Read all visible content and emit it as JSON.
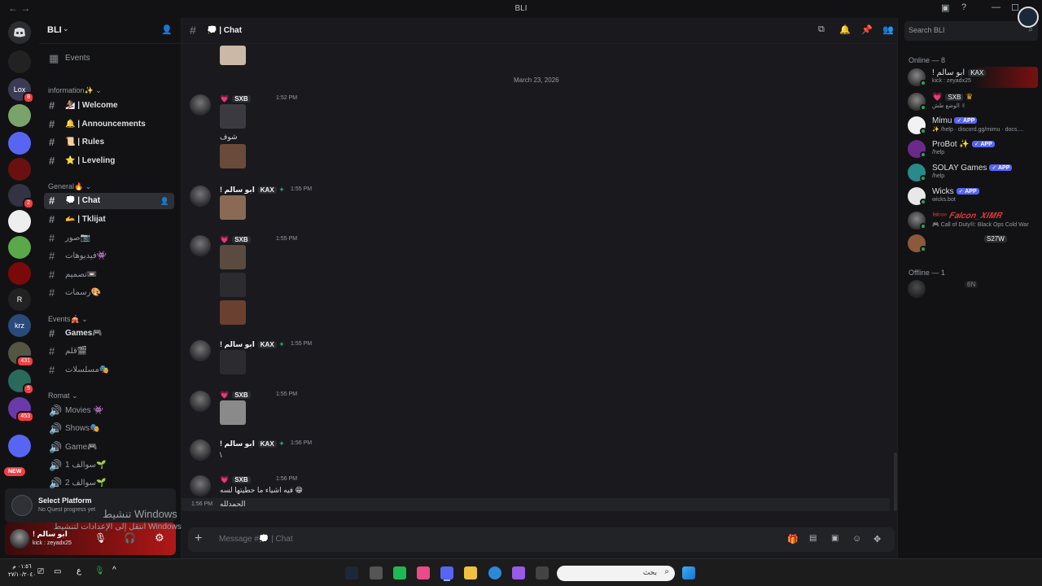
{
  "window": {
    "title": "BLI"
  },
  "server": {
    "name": "BLI"
  },
  "sidebar": {
    "events_label": "Events",
    "categories": [
      {
        "label": "information✨"
      },
      {
        "label": "General🔥"
      },
      {
        "label": "Events🎪"
      },
      {
        "label": "Romat"
      }
    ],
    "channels": [
      {
        "label": "🏂 | Welcome"
      },
      {
        "label": "🔔 | Announcements"
      },
      {
        "label": "📜 | Rules"
      },
      {
        "label": "⭐ | Leveling"
      },
      {
        "label": "💭 | Chat"
      },
      {
        "label": "🫴 | Tklijat"
      },
      {
        "label": "صور📷"
      },
      {
        "label": "فيديوهات👾"
      },
      {
        "label": "تصميم📼"
      },
      {
        "label": "رسمات🎨"
      },
      {
        "label": "Games🎮"
      },
      {
        "label": "قلم🎬"
      },
      {
        "label": "مسلسلات🎭"
      },
      {
        "label": "Movies 👾"
      },
      {
        "label": "Shows🎭"
      },
      {
        "label": "Game🎮"
      },
      {
        "label": "سوالف 1🌱"
      },
      {
        "label": "سوالف 2🌱"
      }
    ]
  },
  "rail": {
    "badges": [
      "8",
      "2",
      "431",
      "5",
      "453"
    ],
    "new_label": "NEW"
  },
  "quest": {
    "title": "Select Platform",
    "subtitle": "No Quest progress yet"
  },
  "user": {
    "name": "! ابو سالم",
    "status": "kick : zeyadx25"
  },
  "chat": {
    "channel": "💭 | Chat",
    "date_divider": "March 23, 2026",
    "messages": [
      {
        "name": "",
        "tag": "SXB",
        "time": "1:52 PM",
        "text": "شوف"
      },
      {
        "name": "! ابو سالم",
        "tag": "KAX",
        "time": "1:55 PM",
        "text": ""
      },
      {
        "name": "",
        "tag": "SXB",
        "time": "1:55 PM",
        "text": ""
      },
      {
        "name": "! ابو سالم",
        "tag": "KAX",
        "time": "1:55 PM",
        "text": ""
      },
      {
        "name": "",
        "tag": "SXB",
        "time": "1:55 PM",
        "text": ""
      },
      {
        "name": "! ابو سالم",
        "tag": "KAX",
        "time": "1:56 PM",
        "text": "\\"
      },
      {
        "name": "",
        "tag": "SXB",
        "time": "1:56 PM",
        "text": "فيه اشياء ما حطيتها لسه 😁"
      },
      {
        "name": "",
        "tag": "",
        "time": "1:56 PM",
        "text": "الحمدلله"
      }
    ],
    "composer_placeholder": "Message #💭 | Chat"
  },
  "header_search": {
    "placeholder": "Search BLI"
  },
  "members": {
    "online_header": "Online — 8",
    "offline_header": "Offline — 1",
    "list": [
      {
        "name": "! ابو سالم",
        "tag": "KAX",
        "status": "kick : zeyadx25",
        "app": false
      },
      {
        "name": "",
        "tag": "SXB",
        "status": "الوضع طش ✌",
        "app": false
      },
      {
        "name": "Mimu",
        "tag": "",
        "status": "✨ /help · discord.gg/mimu · docs....",
        "app": true
      },
      {
        "name": "ProBot ✨",
        "tag": "",
        "status": "/help",
        "app": true
      },
      {
        "name": "SOLAY Games",
        "tag": "",
        "status": "/help",
        "app": true
      },
      {
        "name": "Wicks",
        "tag": "",
        "status": "wicks.bot",
        "app": true
      },
      {
        "name": "ᶠᵃˡᶜᵒⁿ 𝑭𝒂𝒍𝒄𝒐𝒏_𝑿𝑰𝑴𝑹",
        "tag": "",
        "status": "🎮 Call of Duty®: Black Ops Cold War",
        "app": false
      },
      {
        "name": "",
        "tag": "S27W",
        "status": "",
        "app": false
      }
    ],
    "offline": [
      {
        "name": "",
        "tag": "6N"
      }
    ],
    "app_label": "✓ APP"
  },
  "overlay": {
    "activate_title": "تنشيط Windows",
    "activate_sub": "انتقل إلى الإعدادات لتنشيط Windows"
  },
  "taskbar": {
    "search_placeholder": "بحث",
    "clock_time": "٠١:٥٦ م",
    "clock_date": "٢٧/١٠/٢٠٤٠",
    "lang": "ع"
  },
  "colors": {
    "accent": "#5865f2",
    "online": "#23a55a",
    "danger": "#f23f43",
    "panel": "#121214",
    "chat_bg": "#1a1a1e"
  }
}
